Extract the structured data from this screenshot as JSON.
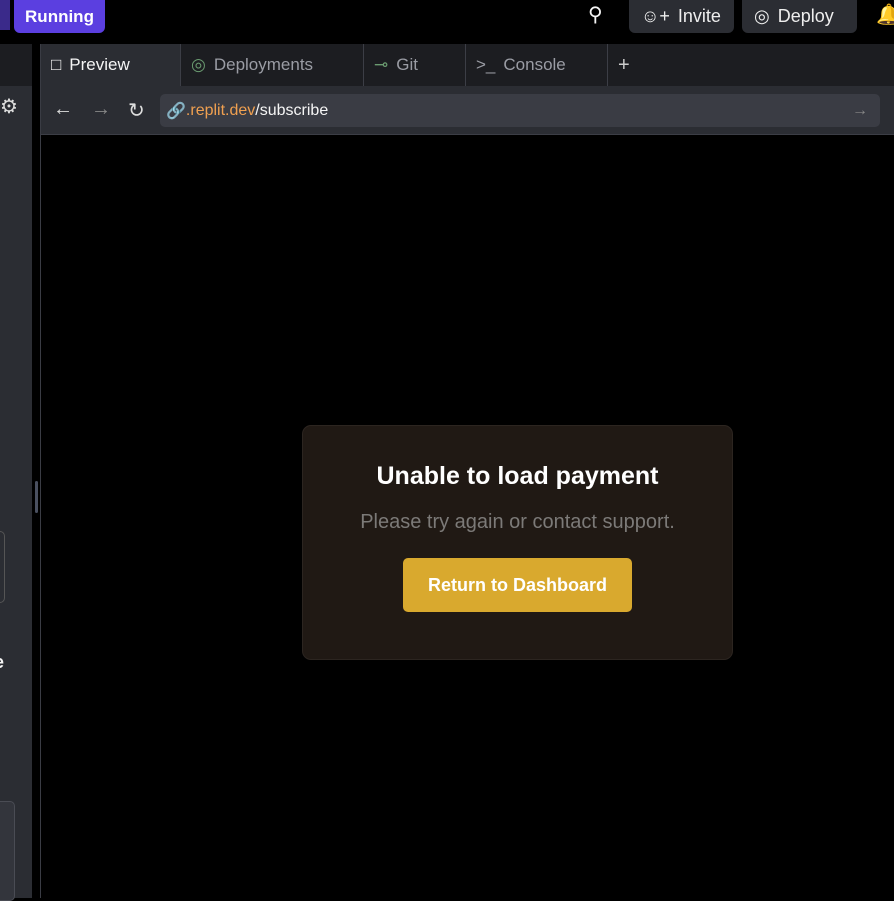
{
  "topbar": {
    "run_status": "Running",
    "invite": "Invite",
    "deploy": "Deploy"
  },
  "tabs": [
    {
      "label": "Preview",
      "icon": "monitor-icon"
    },
    {
      "label": "Deployments",
      "icon": "globe-upload-icon"
    },
    {
      "label": "Git",
      "icon": "git-branch-icon"
    },
    {
      "label": "Console",
      "icon": "terminal-icon"
    }
  ],
  "address": {
    "domain": ".replit.dev",
    "path": "/subscribe"
  },
  "card": {
    "title": "Unable to load payment",
    "message": "Please try again or contact support.",
    "button": "Return to Dashboard"
  },
  "sidebar": {
    "fragment": "e"
  },
  "colors": {
    "accent": "#5b3fe0",
    "button": "#d9a92e",
    "domain": "#f0a050"
  }
}
